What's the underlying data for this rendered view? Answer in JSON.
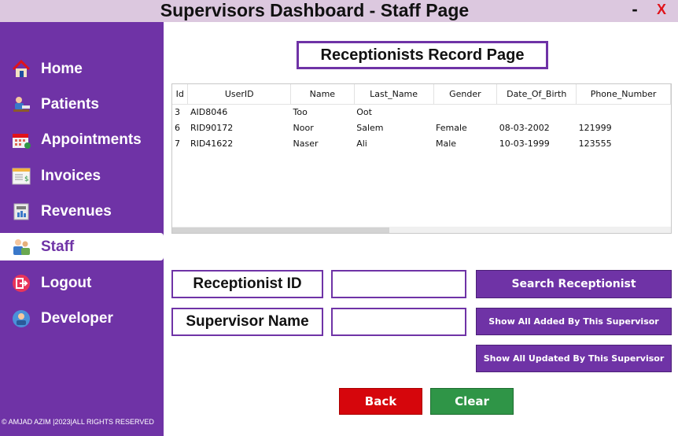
{
  "window": {
    "title": "Supervisors Dashboard - Staff Page",
    "minimize_label": "-",
    "close_label": "X"
  },
  "sidebar": {
    "items": [
      {
        "label": "Home",
        "icon": "home-icon",
        "active": false
      },
      {
        "label": "Patients",
        "icon": "patients-icon",
        "active": false
      },
      {
        "label": "Appointments",
        "icon": "calendar-icon",
        "active": false
      },
      {
        "label": "Invoices",
        "icon": "invoice-icon",
        "active": false
      },
      {
        "label": "Revenues",
        "icon": "revenue-icon",
        "active": false
      },
      {
        "label": "Staff",
        "icon": "staff-icon",
        "active": true
      },
      {
        "label": "Logout",
        "icon": "logout-icon",
        "active": false
      },
      {
        "label": "Developer",
        "icon": "developer-icon",
        "active": false
      }
    ],
    "copyright": "© AMJAD AZIM |2023|ALL RIGHTS RESERVED"
  },
  "main": {
    "heading": "Receptionists Record Page",
    "table": {
      "columns": [
        "Id",
        "UserID",
        "Name",
        "Last_Name",
        "Gender",
        "Date_Of_Birth",
        "Phone_Number"
      ],
      "rows": [
        [
          "3",
          "AID8046",
          "Too",
          "Oot",
          "",
          "",
          ""
        ],
        [
          "6",
          "RID90172",
          "Noor",
          "Salem",
          "Female",
          "08-03-2002",
          "121999"
        ],
        [
          "7",
          "RID41622",
          "Naser",
          "Ali",
          "Male",
          "10-03-1999",
          "123555"
        ]
      ]
    },
    "form": {
      "receptionist_id_label": "Receptionist ID",
      "receptionist_id_value": "",
      "supervisor_name_label": "Supervisor Name",
      "supervisor_name_value": ""
    },
    "buttons": {
      "search": "Search Receptionist",
      "show_added": "Show All Added By This Supervisor",
      "show_updated": "Show All Updated By This Supervisor",
      "back": "Back",
      "clear": "Clear"
    }
  },
  "colors": {
    "primary": "#6f33a6",
    "titlebar": "#dcc8df",
    "back": "#d6060c",
    "clear": "#2f9547",
    "close": "#e0121a"
  }
}
